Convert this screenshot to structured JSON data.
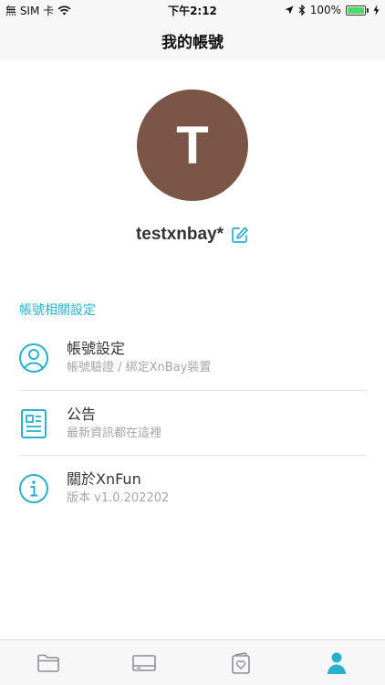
{
  "status_bar": {
    "carrier": "無 SIM 卡",
    "time": "下午2:12",
    "battery_percent": "100%",
    "icons": [
      "wifi-icon",
      "location-icon",
      "bluetooth-icon",
      "battery-icon",
      "charging-icon"
    ]
  },
  "header": {
    "title": "我的帳號"
  },
  "profile": {
    "avatar_letter": "T",
    "avatar_color": "#7a5548",
    "username": "testxnbay*"
  },
  "settings": {
    "section_title": "帳號相關設定",
    "items": [
      {
        "icon": "user-circle-icon",
        "title": "帳號設定",
        "subtitle": "帳號驗證 / 綁定XnBay裝置"
      },
      {
        "icon": "news-icon",
        "title": "公告",
        "subtitle": "最新資訊都在這裡"
      },
      {
        "icon": "info-icon",
        "title": "關於XnFun",
        "subtitle": "版本 v1.0.202202"
      }
    ]
  },
  "tab_bar": {
    "tabs": [
      {
        "icon": "folder-icon",
        "active": false
      },
      {
        "icon": "device-icon",
        "active": false
      },
      {
        "icon": "favorites-icon",
        "active": false
      },
      {
        "icon": "profile-icon",
        "active": true
      }
    ]
  },
  "colors": {
    "accent": "#2ab0cf",
    "inactive": "#8e8e93"
  }
}
